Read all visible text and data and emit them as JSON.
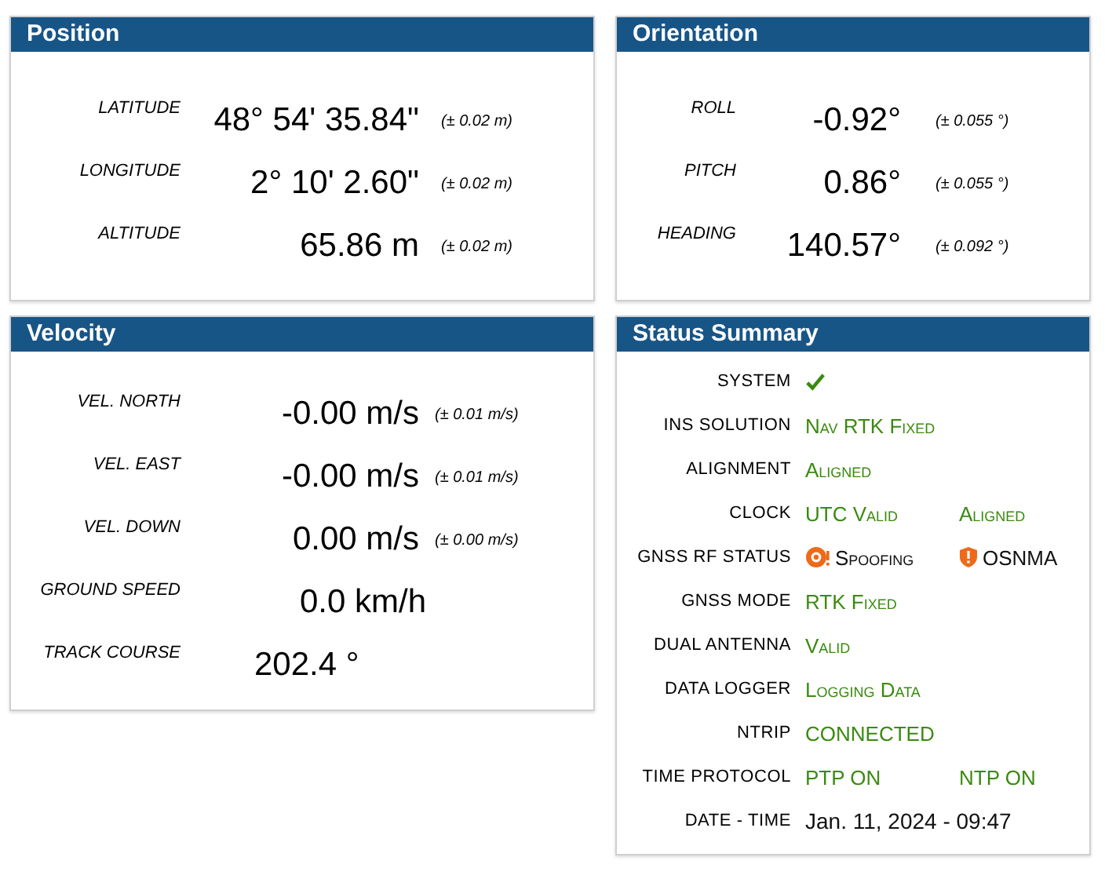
{
  "panels": [
    {
      "title": "Position",
      "kind": "measure",
      "rows": [
        {
          "label": "LATITUDE",
          "value": "48° 54' 35.84\"",
          "uncertainty": "(± 0.02 m)"
        },
        {
          "label": "LONGITUDE",
          "value": "2° 10' 2.60\"",
          "uncertainty": "(± 0.02 m)"
        },
        {
          "label": "ALTITUDE",
          "value": "65.86 m",
          "uncertainty": "(± 0.02 m)"
        }
      ]
    },
    {
      "title": "Orientation",
      "kind": "measure",
      "rows": [
        {
          "label": "ROLL",
          "value": "-0.92°",
          "uncertainty": "(± 0.055 °)"
        },
        {
          "label": "PITCH",
          "value": "0.86°",
          "uncertainty": "(± 0.055 °)"
        },
        {
          "label": "HEADING",
          "value": "140.57°",
          "uncertainty": "(± 0.092 °)"
        }
      ]
    },
    {
      "title": "Velocity",
      "kind": "measure",
      "rows": [
        {
          "label": "VEL. NORTH",
          "value": "-0.00 m/s",
          "uncertainty": "(± 0.01 m/s)"
        },
        {
          "label": "VEL. EAST",
          "value": "-0.00 m/s",
          "uncertainty": "(± 0.01 m/s)"
        },
        {
          "label": "VEL. DOWN",
          "value": "0.00 m/s",
          "uncertainty": "(± 0.00 m/s)"
        },
        {
          "label": "GROUND SPEED",
          "value": "0.0 km/h"
        },
        {
          "label": "TRACK COURSE",
          "value": "202.4 °"
        }
      ]
    },
    {
      "title": "Status Summary",
      "kind": "status",
      "rows": [
        {
          "label": "SYSTEM",
          "values": [
            {
              "kind": "check"
            }
          ]
        },
        {
          "label": "INS SOLUTION",
          "values": [
            {
              "kind": "ok",
              "text": "Nav RTK Fixed"
            }
          ]
        },
        {
          "label": "ALIGNMENT",
          "values": [
            {
              "kind": "ok",
              "text": "Aligned"
            }
          ]
        },
        {
          "label": "CLOCK",
          "values": [
            {
              "kind": "ok",
              "text": "UTC Valid"
            },
            {
              "kind": "ok",
              "text": "Aligned"
            }
          ]
        },
        {
          "label": "GNSS RF STATUS",
          "values": [
            {
              "kind": "alert-ring",
              "text": "Spoofing"
            },
            {
              "kind": "alert-shield",
              "text": "OSNMA"
            }
          ]
        },
        {
          "label": "GNSS MODE",
          "values": [
            {
              "kind": "ok",
              "text": "RTK Fixed"
            }
          ]
        },
        {
          "label": "DUAL ANTENNA",
          "values": [
            {
              "kind": "ok",
              "text": "Valid"
            }
          ]
        },
        {
          "label": "DATA LOGGER",
          "values": [
            {
              "kind": "ok",
              "text": "Logging Data"
            }
          ]
        },
        {
          "label": "NTRIP",
          "values": [
            {
              "kind": "ok",
              "text": "CONNECTED"
            }
          ]
        },
        {
          "label": "TIME PROTOCOL",
          "values": [
            {
              "kind": "ok",
              "text": "PTP ON"
            },
            {
              "kind": "ok",
              "text": "NTP ON"
            }
          ]
        },
        {
          "label": "DATE - TIME",
          "values": [
            {
              "kind": "plain",
              "text": "Jan. 11, 2024 - 09:47"
            }
          ]
        }
      ]
    }
  ]
}
